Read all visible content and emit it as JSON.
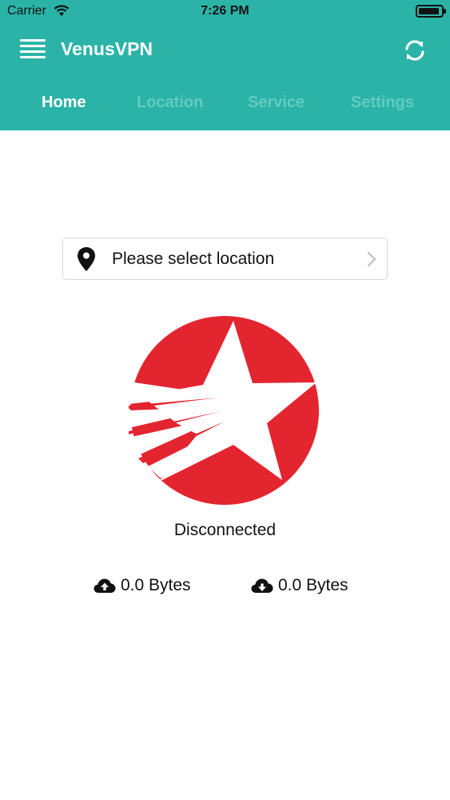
{
  "status_bar": {
    "carrier": "Carrier",
    "time": "7:26 PM"
  },
  "header": {
    "title": "VenusVPN",
    "menu_icon": "hamburger-menu-icon",
    "refresh_icon": "refresh-icon",
    "background_color": "#2bb3a8"
  },
  "tabs": [
    {
      "label": "Home",
      "active": true
    },
    {
      "label": "Location",
      "active": false
    },
    {
      "label": "Service",
      "active": false
    },
    {
      "label": "Settings",
      "active": false
    }
  ],
  "location": {
    "placeholder": "Please select location",
    "icon": "map-pin-icon"
  },
  "connection": {
    "status": "Disconnected",
    "logo_color": "#e32530"
  },
  "traffic": {
    "upload": "0.0 Bytes",
    "download": "0.0 Bytes"
  }
}
